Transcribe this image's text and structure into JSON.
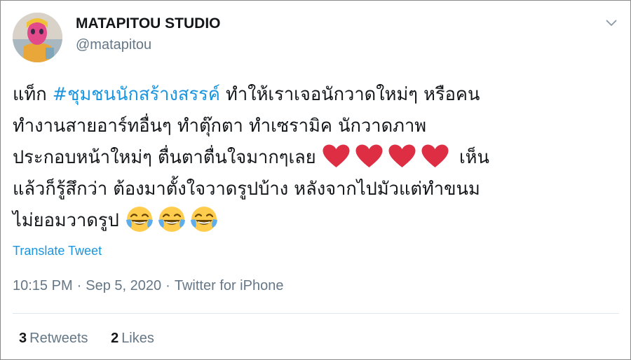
{
  "tweet": {
    "author": {
      "display_name": "MATAPITOU STUDIO",
      "handle": "@matapitou",
      "avatar_icon": "profile-avatar"
    },
    "menu_icon": "chevron-down-icon",
    "text_lines": [
      {
        "prefix": "แท็ก ",
        "hashtag": "#ชุมชนนักสร้างสรรค์",
        "suffix": " ทำให้เราเจอนักวาดใหม่ๆ หรือคน"
      },
      {
        "text": "ทำงานสายอาร์ทอื่นๆ ทำตุ๊กตา ทำเซรามิค นักวาดภาพ"
      },
      {
        "before": "ประกอบหน้าใหม่ๆ ตื่นตาตื่นใจมากๆเลย ",
        "after": " เห็น",
        "emoji": "red-heart-icon",
        "emoji_count": 4
      },
      {
        "text": "แล้วก็รู้สึกว่า ต้องมาตั้งใจวาดรูปบ้าง หลังจากไปมัวแต่ทำขนม"
      },
      {
        "before": "ไม่ยอมวาดรูป ",
        "emoji": "face-with-tears-of-joy-icon",
        "emoji_count": 3
      }
    ],
    "translate_label": "Translate Tweet",
    "time": "10:15 PM",
    "date": "Sep 5, 2020",
    "separator": "·",
    "source": "Twitter for iPhone",
    "retweets": {
      "count": "3",
      "label": "Retweets"
    },
    "likes": {
      "count": "2",
      "label": "Likes"
    }
  },
  "colors": {
    "link": "#1b95e0",
    "text": "#14171a",
    "secondary": "#657786",
    "heart": "#e0245e",
    "divider": "#e1e8ed"
  }
}
